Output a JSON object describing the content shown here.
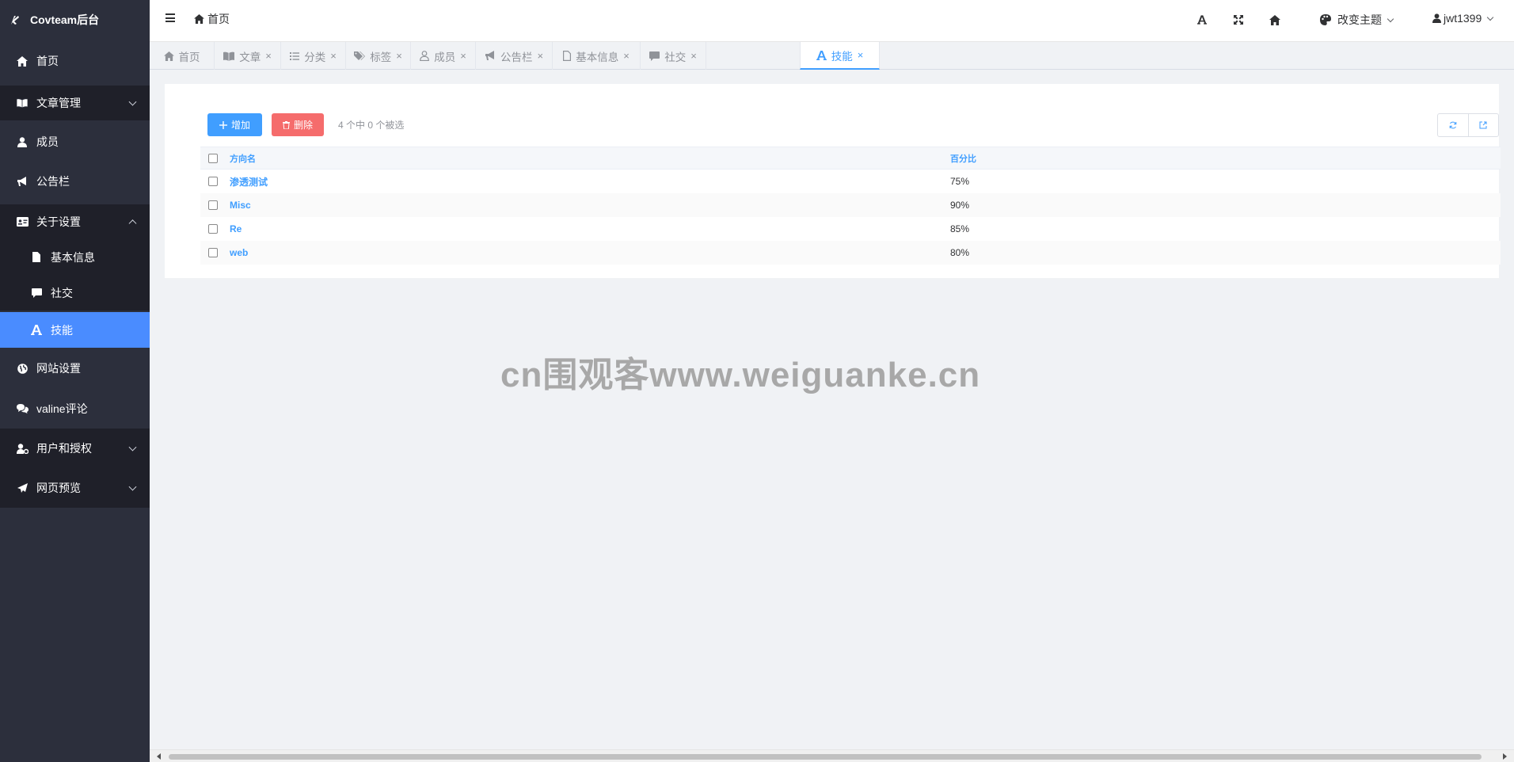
{
  "app": {
    "title": "Covteam后台"
  },
  "sidebar": {
    "items": [
      {
        "label": "首页",
        "icon": "home-icon"
      },
      {
        "label": "文章管理",
        "icon": "book-icon"
      },
      {
        "label": "成员",
        "icon": "user-icon"
      },
      {
        "label": "公告栏",
        "icon": "bullhorn-icon"
      },
      {
        "label": "关于设置",
        "icon": "id-card-icon"
      },
      {
        "label": "基本信息",
        "icon": "file-icon"
      },
      {
        "label": "社交",
        "icon": "comment-icon"
      },
      {
        "label": "技能",
        "icon": "font-icon"
      },
      {
        "label": "网站设置",
        "icon": "globe-icon"
      },
      {
        "label": "valine评论",
        "icon": "comments-icon"
      },
      {
        "label": "用户和授权",
        "icon": "user-cog-icon"
      },
      {
        "label": "网页预览",
        "icon": "paper-plane-icon"
      }
    ],
    "active": "技能"
  },
  "header": {
    "breadcrumb": "首页",
    "theme_label": "改变主题",
    "username": "jwt1399"
  },
  "tabs": [
    {
      "label": "首页",
      "icon": "home-icon",
      "closable": false
    },
    {
      "label": "文章",
      "icon": "book-icon",
      "closable": true
    },
    {
      "label": "分类",
      "icon": "list-icon",
      "closable": true
    },
    {
      "label": "标签",
      "icon": "tags-icon",
      "closable": true
    },
    {
      "label": "成员",
      "icon": "user-icon",
      "closable": true
    },
    {
      "label": "公告栏",
      "icon": "bullhorn-icon",
      "closable": true
    },
    {
      "label": "基本信息",
      "icon": "file-icon",
      "closable": true
    },
    {
      "label": "社交",
      "icon": "comment-icon",
      "closable": true
    },
    {
      "label": "技能",
      "icon": "font-icon",
      "closable": true,
      "active": true
    }
  ],
  "toolbar": {
    "add_label": "增加",
    "delete_label": "删除",
    "selection_info": "4 个中 0 个被选"
  },
  "table": {
    "columns": [
      "方向名",
      "百分比"
    ],
    "rows": [
      {
        "name": "渗透测试",
        "percent": "75%"
      },
      {
        "name": "Misc",
        "percent": "90%"
      },
      {
        "name": "Re",
        "percent": "85%"
      },
      {
        "name": "web",
        "percent": "80%"
      }
    ]
  },
  "watermark": "cn围观客www.weiguanke.cn",
  "colors": {
    "sidebar_bg": "#2c2f3c",
    "sidebar_active": "#4a8cff",
    "primary": "#409eff",
    "danger": "#f56c6c"
  }
}
